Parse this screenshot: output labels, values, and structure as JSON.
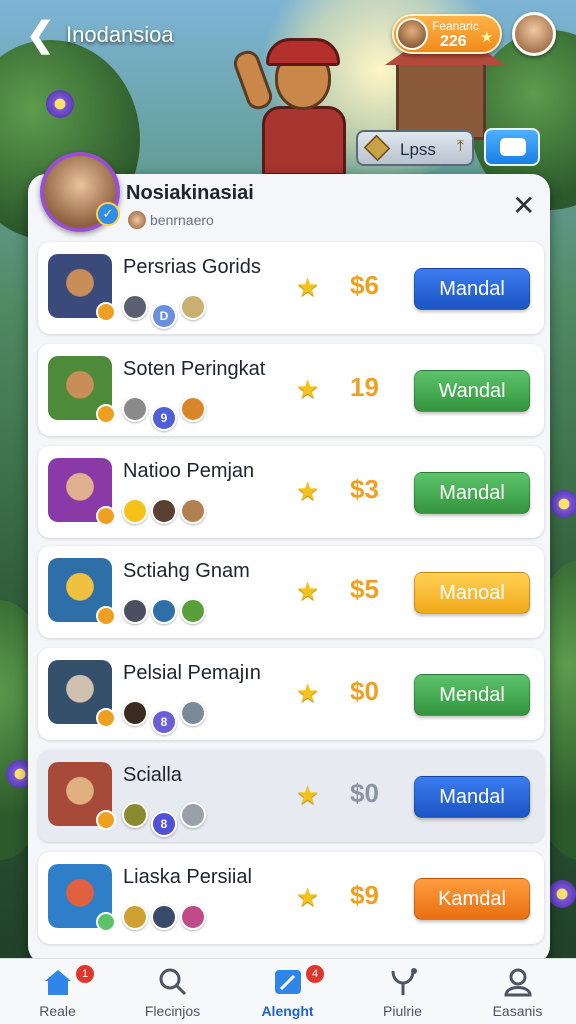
{
  "header": {
    "title": "Inodansioa",
    "currency": {
      "label": "Feanaric",
      "value": "226"
    }
  },
  "tips_button": {
    "label": "Lpss"
  },
  "panel": {
    "title": "Nosiakinasiai",
    "subtitle": "benrnaero",
    "rows": [
      {
        "name": "Persrias Gorids",
        "price": "$6",
        "button": "Mandal",
        "button_color": "blue",
        "tags": [
          "",
          "D",
          ""
        ]
      },
      {
        "name": "Soten Peringkat",
        "price": "19",
        "button": "Wandal",
        "button_color": "green",
        "tags": [
          "",
          "9",
          ""
        ]
      },
      {
        "name": "Natioo Pemjan",
        "price": "$3",
        "button": "Mandal",
        "button_color": "green",
        "tags": [
          "",
          "",
          ""
        ]
      },
      {
        "name": "Sctiahg Gnam",
        "price": "$5",
        "button": "Manoal",
        "button_color": "yellow",
        "tags": [
          "",
          "",
          ""
        ]
      },
      {
        "name": "Pelsial Pemajın",
        "price": "$0",
        "button": "Mendal",
        "button_color": "green",
        "tags": [
          "",
          "8",
          ""
        ]
      },
      {
        "name": "Scialla",
        "price": "$0",
        "button": "Mandal",
        "button_color": "blue",
        "tags": [
          "",
          "8",
          ""
        ]
      },
      {
        "name": "Liaska Persiial",
        "price": "$9",
        "button": "Kamdal",
        "button_color": "orange",
        "tags": [
          "",
          "",
          ""
        ]
      }
    ]
  },
  "nav": {
    "items": [
      {
        "label": "Reale",
        "badge": "1",
        "icon": "home-icon"
      },
      {
        "label": "Flecinjos",
        "icon": "search-icon"
      },
      {
        "label": "Alenght",
        "badge": "4",
        "icon": "edit-icon",
        "active": true
      },
      {
        "label": "Piulrie",
        "icon": "stethoscope-icon"
      },
      {
        "label": "Easanis",
        "icon": "user-icon"
      }
    ]
  },
  "colors": {
    "accent_blue": "#1c55c4",
    "green": "#34963f",
    "yellow": "#f2a91a",
    "orange": "#ea6f10",
    "price_gold": "#f0a020"
  }
}
